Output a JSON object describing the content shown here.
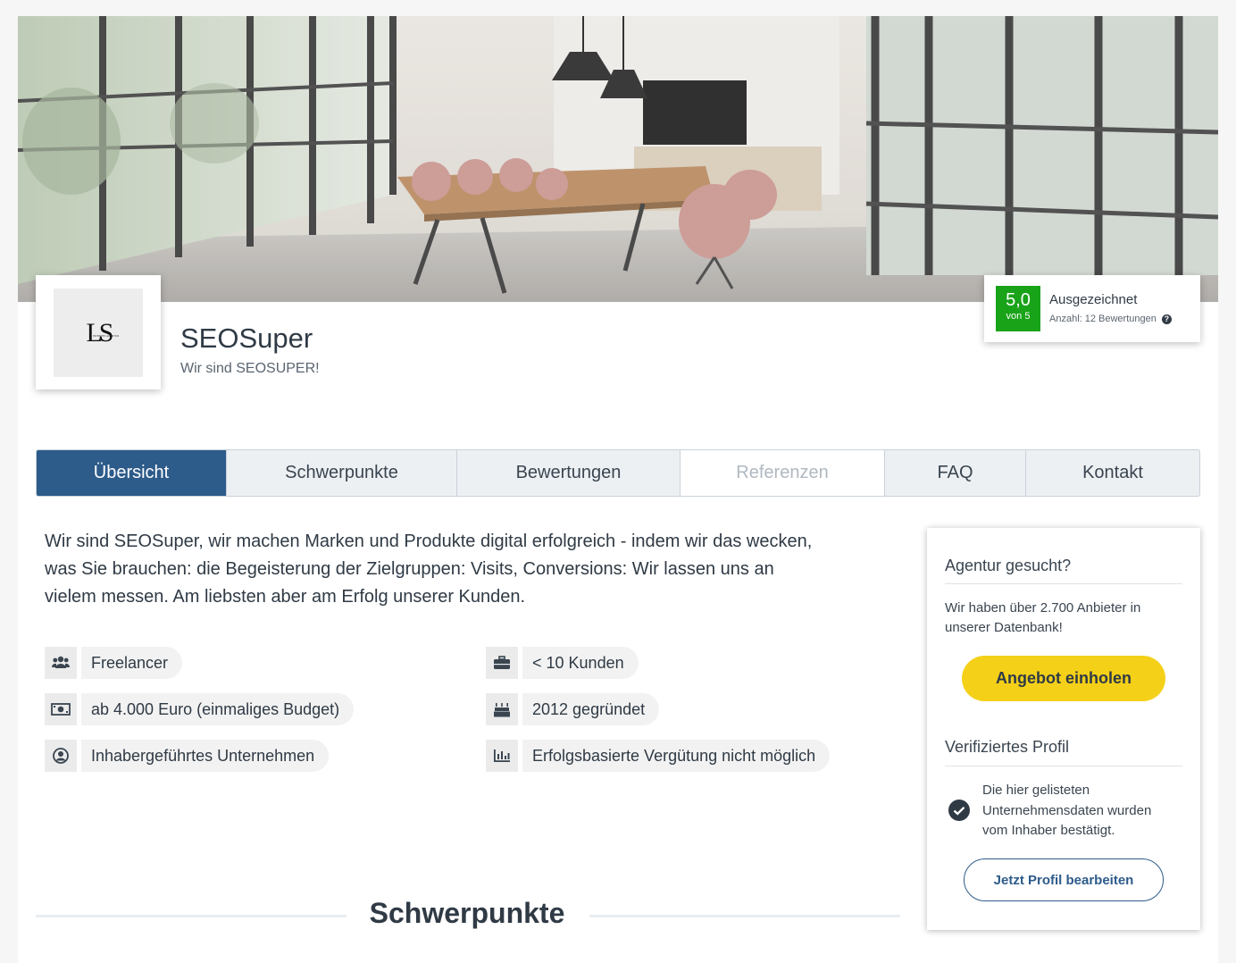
{
  "profile": {
    "logo_text": "LS",
    "logo_subtext": "INTERNET AGENTUR",
    "name": "SEOSuper",
    "tagline": "Wir sind SEOSUPER!"
  },
  "rating": {
    "value": "5,0",
    "of": "von 5",
    "label": "Ausgezeichnet",
    "count": "Anzahl: 12 Bewertungen",
    "badge_color": "#19a319"
  },
  "tabs": [
    {
      "label": "Übersicht",
      "state": "active"
    },
    {
      "label": "Schwerpunkte",
      "state": "normal"
    },
    {
      "label": "Bewertungen",
      "state": "normal"
    },
    {
      "label": "Referenzen",
      "state": "disabled"
    },
    {
      "label": "FAQ",
      "state": "normal"
    },
    {
      "label": "Kontakt",
      "state": "normal"
    }
  ],
  "description": "Wir sind SEOSuper, wir machen Marken und Produkte digital erfolgreich - indem wir das wecken, was Sie brauchen: die Begeisterung der Zielgruppen: Visits, Conversions: Wir lassen uns an vielem messen. Am liebsten aber am Erfolg unserer Kunden.",
  "facts": [
    {
      "icon": "users-icon",
      "text": "Freelancer"
    },
    {
      "icon": "briefcase-icon",
      "text": "< 10 Kunden"
    },
    {
      "icon": "money-icon",
      "text": "ab 4.000 Euro (einmaliges Budget)"
    },
    {
      "icon": "cake-icon",
      "text": "2012 gegründet"
    },
    {
      "icon": "user-circle-icon",
      "text": "Inhabergeführtes Unternehmen"
    },
    {
      "icon": "bar-chart-icon",
      "text": "Erfolgsbasierte Vergütung nicht möglich"
    }
  ],
  "sidebar": {
    "search_title": "Agentur gesucht?",
    "search_text": "Wir haben über 2.700 Anbieter in unserer Datenbank!",
    "offer_button": "Angebot einholen",
    "verified_title": "Verifiziertes Profil",
    "verified_text": "Die hier gelisteten Unternehmensdaten wurden vom Inhaber bestätigt.",
    "edit_button": "Jetzt Profil bearbeiten"
  },
  "section_heading": "Schwerpunkte",
  "colors": {
    "primary": "#2d5b8a",
    "accent": "#f5d018",
    "text": "#2f3a45"
  }
}
